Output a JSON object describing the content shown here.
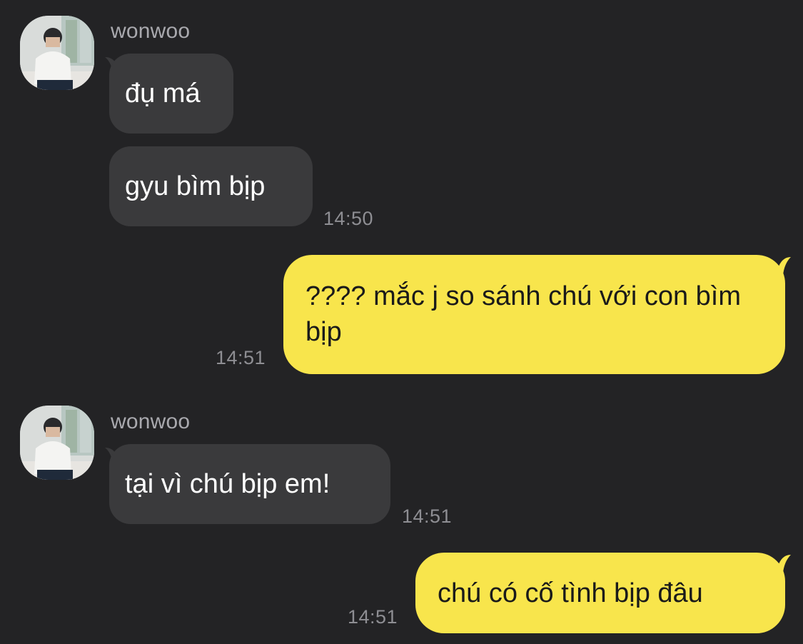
{
  "messages": [
    {
      "sender": "wonwoo",
      "text": "đụ má"
    },
    {
      "text": "gyu bìm bịp",
      "time": "14:50"
    },
    {
      "text": "???? mắc j so sánh chú với con bìm bịp",
      "time": "14:51"
    },
    {
      "sender": "wonwoo",
      "text": "tại vì chú bịp em!",
      "time": "14:51"
    },
    {
      "text": "chú có cố tình bịp đâu",
      "time": "14:51"
    }
  ],
  "colors": {
    "background": "#232325",
    "incoming_bubble": "#3a3a3c",
    "outgoing_bubble": "#f8e54c",
    "incoming_text": "#ffffff",
    "outgoing_text": "#1a1a1a",
    "meta_text": "#8e8e93"
  }
}
